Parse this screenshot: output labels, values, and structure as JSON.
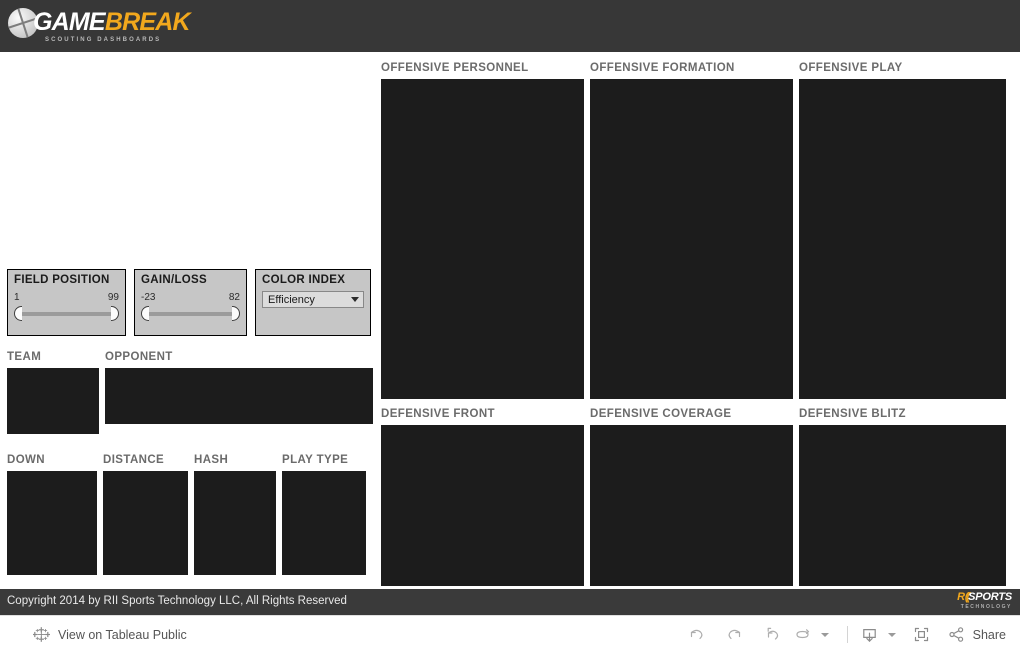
{
  "brand": {
    "logo_game": "GAME",
    "logo_break": "BREAK",
    "logo_subtitle": "SCOUTING DASHBOARDS",
    "ball_icon": "football-icon"
  },
  "filters": {
    "field_position": {
      "title": "FIELD POSITION",
      "min_label": "1",
      "max_label": "99"
    },
    "gain_loss": {
      "title": "GAIN/LOSS",
      "min_label": "-23",
      "max_label": "82"
    },
    "color_index": {
      "title": "COLOR INDEX",
      "selected": "Efficiency"
    }
  },
  "panels": {
    "team": "TEAM",
    "opponent": "OPPONENT",
    "down": "DOWN",
    "distance": "DISTANCE",
    "hash": "HASH",
    "play_type": "PLAY TYPE"
  },
  "viz": {
    "offensive_personnel": "OFFENSIVE PERSONNEL",
    "offensive_formation": "OFFENSIVE FORMATION",
    "offensive_play": "OFFENSIVE PLAY",
    "defensive_front": "DEFENSIVE FRONT",
    "defensive_coverage": "DEFENSIVE COVERAGE",
    "defensive_blitz": "DEFENSIVE BLITZ"
  },
  "footer": {
    "copyright": "Copyright 2014 by RII Sports Technology LLC, All Rights Reserved",
    "company_r": "R",
    "company_slashes": "((",
    "company_name": "SPORTS",
    "company_sub": "TECHNOLOGY"
  },
  "toolbar": {
    "view_label": "View on Tableau Public",
    "share_label": "Share",
    "icons": {
      "tableau": "tableau-icon",
      "undo": "undo-icon",
      "redo": "redo-icon",
      "revert": "revert-icon",
      "refresh": "refresh-icon",
      "download": "download-icon",
      "fullscreen": "fullscreen-icon",
      "share": "share-icon"
    }
  },
  "colors": {
    "brand_accent": "#f2a81d",
    "header_bg": "#373737",
    "panel_dark": "#1c1c1c",
    "filter_bg": "#c6c6c6",
    "footer_bg": "#3a3a3a"
  }
}
